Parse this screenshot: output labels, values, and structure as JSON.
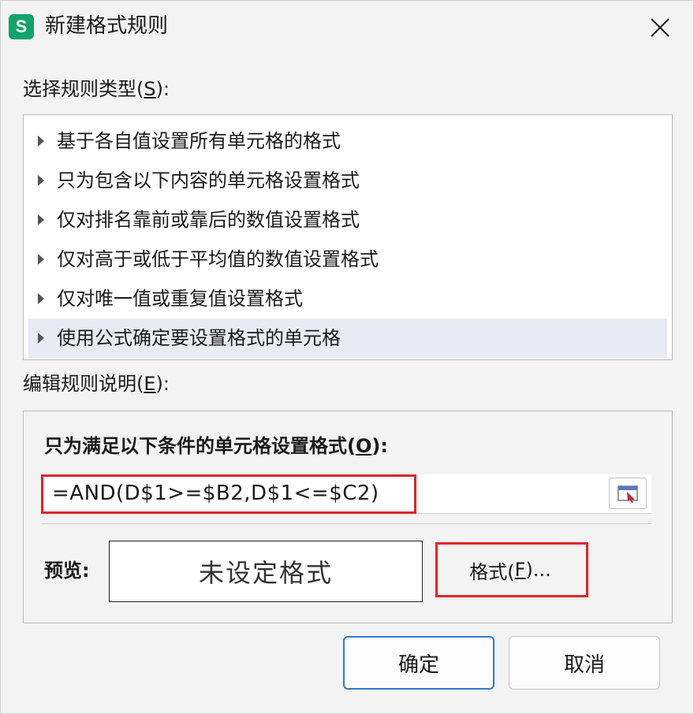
{
  "dialog": {
    "app_icon_letter": "S",
    "title": "新建格式规则",
    "close_glyph": "✕"
  },
  "rule_type": {
    "label": "选择规则类型(",
    "hotkey": "S",
    "label_end": "):",
    "items": [
      {
        "label": "基于各自值设置所有单元格的格式",
        "selected": false
      },
      {
        "label": "只为包含以下内容的单元格设置格式",
        "selected": false
      },
      {
        "label": "仅对排名靠前或靠后的数值设置格式",
        "selected": false
      },
      {
        "label": "仅对高于或低于平均值的数值设置格式",
        "selected": false
      },
      {
        "label": "仅对唯一值或重复值设置格式",
        "selected": false
      },
      {
        "label": "使用公式确定要设置格式的单元格",
        "selected": true
      }
    ]
  },
  "edit_rule": {
    "label": "编辑规则说明(",
    "hotkey": "E",
    "label_end": "):",
    "condition_label": "只为满足以下条件的单元格设置格式(",
    "condition_hotkey": "O",
    "condition_label_end": "):",
    "formula": "=AND(D$1>=$B2,D$1<=$C2)",
    "preview_label": "预览:",
    "preview_text": "未设定格式",
    "format_button": "格式(",
    "format_hotkey": "F",
    "format_button_end": ")..."
  },
  "buttons": {
    "ok": "确定",
    "cancel": "取消"
  },
  "colors": {
    "highlight_red": "#e0242b",
    "app_icon_green": "#11a36b",
    "ok_border_blue": "#2e7bd1",
    "selected_row": "#e8ecf2"
  }
}
